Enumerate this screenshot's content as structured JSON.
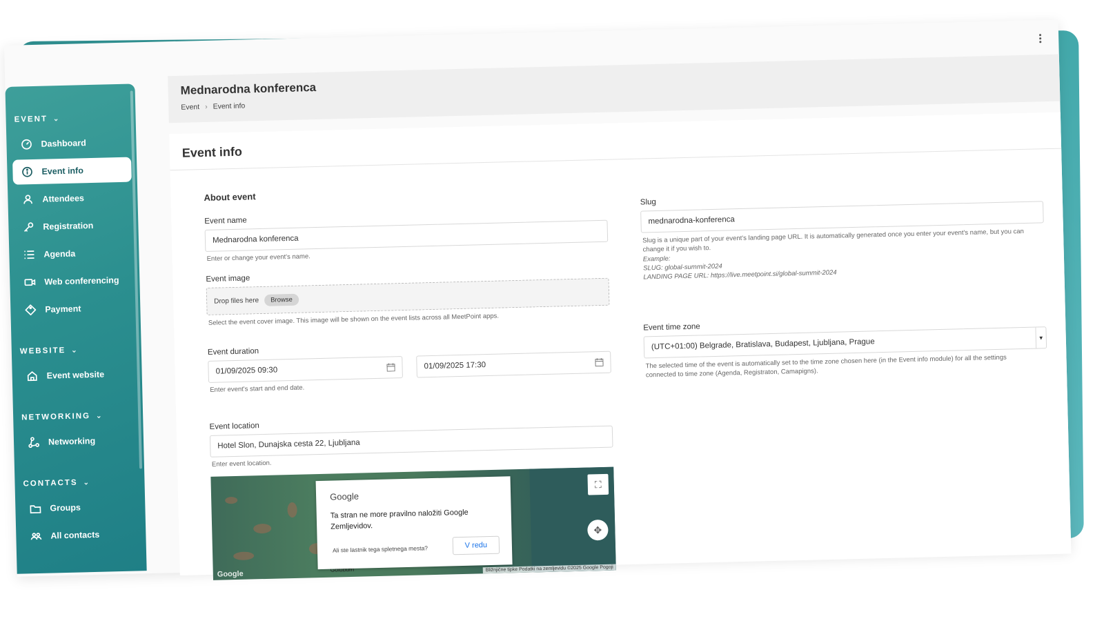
{
  "sidebar": {
    "sections": [
      {
        "title": "EVENT",
        "items": [
          {
            "label": "Dashboard",
            "icon": "dashboard-icon"
          },
          {
            "label": "Event info",
            "icon": "info-icon",
            "active": true
          },
          {
            "label": "Attendees",
            "icon": "person-icon"
          },
          {
            "label": "Registration",
            "icon": "key-icon"
          },
          {
            "label": "Agenda",
            "icon": "list-icon"
          },
          {
            "label": "Web conferencing",
            "icon": "video-icon"
          },
          {
            "label": "Payment",
            "icon": "tag-icon"
          }
        ]
      },
      {
        "title": "WEBSITE",
        "items": [
          {
            "label": "Event website",
            "icon": "home-icon"
          }
        ]
      },
      {
        "title": "NETWORKING",
        "items": [
          {
            "label": "Networking",
            "icon": "network-icon"
          }
        ]
      },
      {
        "title": "CONTACTS",
        "items": [
          {
            "label": "Groups",
            "icon": "folder-icon"
          },
          {
            "label": "All contacts",
            "icon": "people-icon"
          }
        ]
      }
    ]
  },
  "header": {
    "title": "Mednarodna konferenca",
    "breadcrumb": [
      "Event",
      "Event info"
    ]
  },
  "card": {
    "title": "Event info",
    "about_heading": "About event",
    "event_name": {
      "label": "Event name",
      "value": "Mednarodna konferenca",
      "help": "Enter or change your event's name."
    },
    "event_image": {
      "label": "Event image",
      "drop_text": "Drop files here",
      "browse_label": "Browse",
      "help": "Select the event cover image. This image will be shown on the event lists across all MeetPoint apps."
    },
    "event_duration": {
      "label": "Event duration",
      "start": "01/09/2025 09:30",
      "end": "01/09/2025 17:30",
      "help": "Enter event's start and end date."
    },
    "event_location": {
      "label": "Event location",
      "value": "Hotel Slon, Dunajska cesta 22, Ljubljana",
      "help": "Enter event location."
    },
    "slug": {
      "label": "Slug",
      "value": "mednarodna-konferenca",
      "help": "Slug is a unique part of your event's landing page URL. It is automatically generated once you enter your event's name, but you can change it if you wish to.",
      "example_label": "Example:",
      "example_slug": "SLUG: global-summit-2024",
      "example_url": "LANDING PAGE URL: https://live.meetpoint.si/global-summit-2024"
    },
    "time_zone": {
      "label": "Event time zone",
      "value": "(UTC+01:00) Belgrade, Bratislava, Budapest, Ljubljana, Prague",
      "help": "The selected time of the event is automatically set to the time zone chosen here (in the Event info module) for all the settings connected to time zone (Agenda, Registraton, Camapigns)."
    }
  },
  "map": {
    "dialog_logo": "Google",
    "dialog_message": "Ta stran ne more pravilno naložiti Google Zemljevidov.",
    "dialog_owner": "Ali ste lastnik tega spletnega mesta?",
    "dialog_button": "V redu",
    "place_label": "Golubum",
    "footer": "Bližnjične tipke   Podatki na zemljevidu ©2025 Google   Pogoji",
    "watermark": "Google"
  }
}
